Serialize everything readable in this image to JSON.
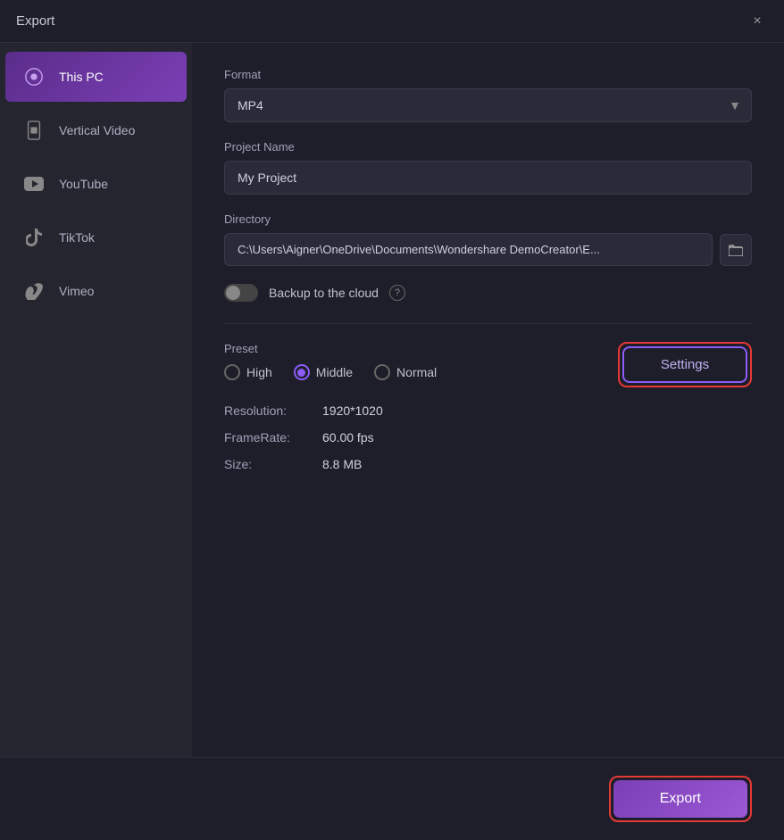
{
  "titleBar": {
    "title": "Export",
    "closeLabel": "×"
  },
  "sidebar": {
    "items": [
      {
        "id": "this-pc",
        "label": "This PC",
        "active": true
      },
      {
        "id": "vertical-video",
        "label": "Vertical Video",
        "active": false
      },
      {
        "id": "youtube",
        "label": "YouTube",
        "active": false
      },
      {
        "id": "tiktok",
        "label": "TikTok",
        "active": false
      },
      {
        "id": "vimeo",
        "label": "Vimeo",
        "active": false
      }
    ]
  },
  "panel": {
    "formatLabel": "Format",
    "formatValue": "MP4",
    "projectNameLabel": "Project Name",
    "projectNameValue": "My Project",
    "directoryLabel": "Directory",
    "directoryValue": "C:\\Users\\Aigner\\OneDrive\\Documents\\Wondershare DemoCreator\\E...",
    "backupLabel": "Backup to the cloud",
    "presetLabel": "Preset",
    "preset": {
      "options": [
        {
          "id": "high",
          "label": "High",
          "checked": false
        },
        {
          "id": "middle",
          "label": "Middle",
          "checked": true
        },
        {
          "id": "normal",
          "label": "Normal",
          "checked": false
        }
      ]
    },
    "settingsLabel": "Settings",
    "resolution": {
      "key": "Resolution:",
      "value": "1920*1020"
    },
    "frameRate": {
      "key": "FrameRate:",
      "value": "60.00 fps"
    },
    "size": {
      "key": "Size:",
      "value": "8.8 MB"
    }
  },
  "exportButton": "Export"
}
